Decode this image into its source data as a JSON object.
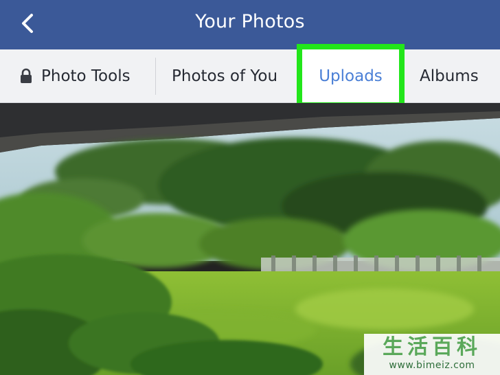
{
  "header": {
    "title": "Your Photos",
    "back_icon": "chevron-left-icon",
    "background_color": "#3b5998"
  },
  "tabs": {
    "photo_tools": {
      "label": "Photo Tools",
      "icon": "lock-icon"
    },
    "photos_of_you": {
      "label": "Photos of You"
    },
    "uploads": {
      "label": "Uploads",
      "selected": true,
      "highlight_color": "#22e61a",
      "text_color": "#4a7fd6"
    },
    "albums": {
      "label": "Albums"
    }
  },
  "watermark": {
    "chinese": "生活百科",
    "url": "www.bimeiz.com"
  }
}
